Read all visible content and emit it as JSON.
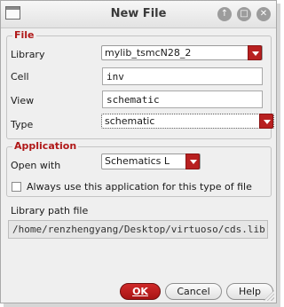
{
  "window": {
    "title": "New File"
  },
  "file_group": {
    "title": "File",
    "library_label": "Library",
    "library_value": "mylib_tsmcN28_2",
    "cell_label": "Cell",
    "cell_value": "inv",
    "view_label": "View",
    "view_value": "schematic",
    "type_label": "Type",
    "type_value": "schematic"
  },
  "application_group": {
    "title": "Application",
    "open_with_label": "Open with",
    "open_with_value": "Schematics L",
    "always_checkbox_label": "Always use this application for this type of file",
    "always_checked": false
  },
  "library_path": {
    "label": "Library path file",
    "value": "/home/renzhengyang/Desktop/virtuoso/cds.lib"
  },
  "buttons": {
    "ok_label": "OK",
    "cancel_label": "Cancel",
    "help_label": "Help"
  },
  "colors": {
    "accent": "#b82020",
    "group_title": "#b01818"
  }
}
